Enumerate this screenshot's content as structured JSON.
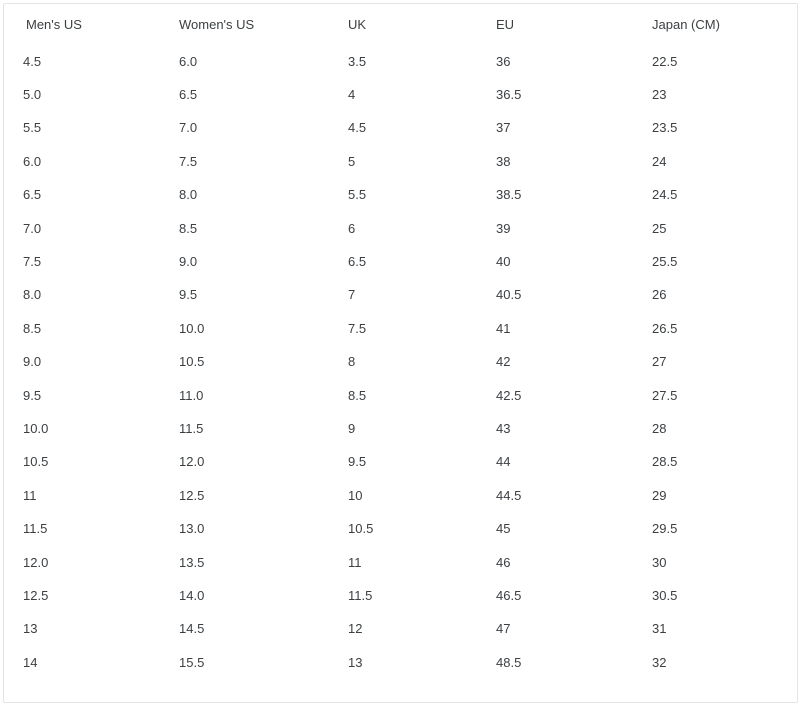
{
  "card": {
    "border_color": "#e4e4e4",
    "background": "#ffffff"
  },
  "text_color": "#3c4043",
  "table": {
    "columns": [
      {
        "key": "mens",
        "label": "Men's US"
      },
      {
        "key": "womens",
        "label": "Women's US"
      },
      {
        "key": "uk",
        "label": "UK"
      },
      {
        "key": "eu",
        "label": "EU"
      },
      {
        "key": "japan",
        "label": "Japan (CM)"
      }
    ],
    "rows": [
      {
        "mens": "4.5",
        "womens": "6.0",
        "uk": "3.5",
        "eu": "36",
        "japan": "22.5"
      },
      {
        "mens": "5.0",
        "womens": "6.5",
        "uk": "4",
        "eu": "36.5",
        "japan": "23"
      },
      {
        "mens": "5.5",
        "womens": "7.0",
        "uk": "4.5",
        "eu": "37",
        "japan": "23.5"
      },
      {
        "mens": "6.0",
        "womens": "7.5",
        "uk": "5",
        "eu": "38",
        "japan": "24"
      },
      {
        "mens": "6.5",
        "womens": "8.0",
        "uk": "5.5",
        "eu": "38.5",
        "japan": "24.5"
      },
      {
        "mens": "7.0",
        "womens": "8.5",
        "uk": "6",
        "eu": "39",
        "japan": "25"
      },
      {
        "mens": "7.5",
        "womens": "9.0",
        "uk": "6.5",
        "eu": "40",
        "japan": "25.5"
      },
      {
        "mens": "8.0",
        "womens": "9.5",
        "uk": "7",
        "eu": "40.5",
        "japan": "26"
      },
      {
        "mens": "8.5",
        "womens": "10.0",
        "uk": "7.5",
        "eu": "41",
        "japan": "26.5"
      },
      {
        "mens": "9.0",
        "womens": "10.5",
        "uk": "8",
        "eu": "42",
        "japan": "27"
      },
      {
        "mens": "9.5",
        "womens": "11.0",
        "uk": "8.5",
        "eu": "42.5",
        "japan": "27.5"
      },
      {
        "mens": "10.0",
        "womens": "11.5",
        "uk": "9",
        "eu": "43",
        "japan": "28"
      },
      {
        "mens": "10.5",
        "womens": "12.0",
        "uk": "9.5",
        "eu": "44",
        "japan": "28.5"
      },
      {
        "mens": "11",
        "womens": "12.5",
        "uk": "10",
        "eu": "44.5",
        "japan": "29"
      },
      {
        "mens": "11.5",
        "womens": "13.0",
        "uk": "10.5",
        "eu": "45",
        "japan": "29.5"
      },
      {
        "mens": "12.0",
        "womens": "13.5",
        "uk": "11",
        "eu": "46",
        "japan": "30"
      },
      {
        "mens": "12.5",
        "womens": "14.0",
        "uk": "11.5",
        "eu": "46.5",
        "japan": "30.5"
      },
      {
        "mens": "13",
        "womens": "14.5",
        "uk": "12",
        "eu": "47",
        "japan": "31"
      },
      {
        "mens": "14",
        "womens": "15.5",
        "uk": "13",
        "eu": "48.5",
        "japan": "32"
      }
    ]
  }
}
